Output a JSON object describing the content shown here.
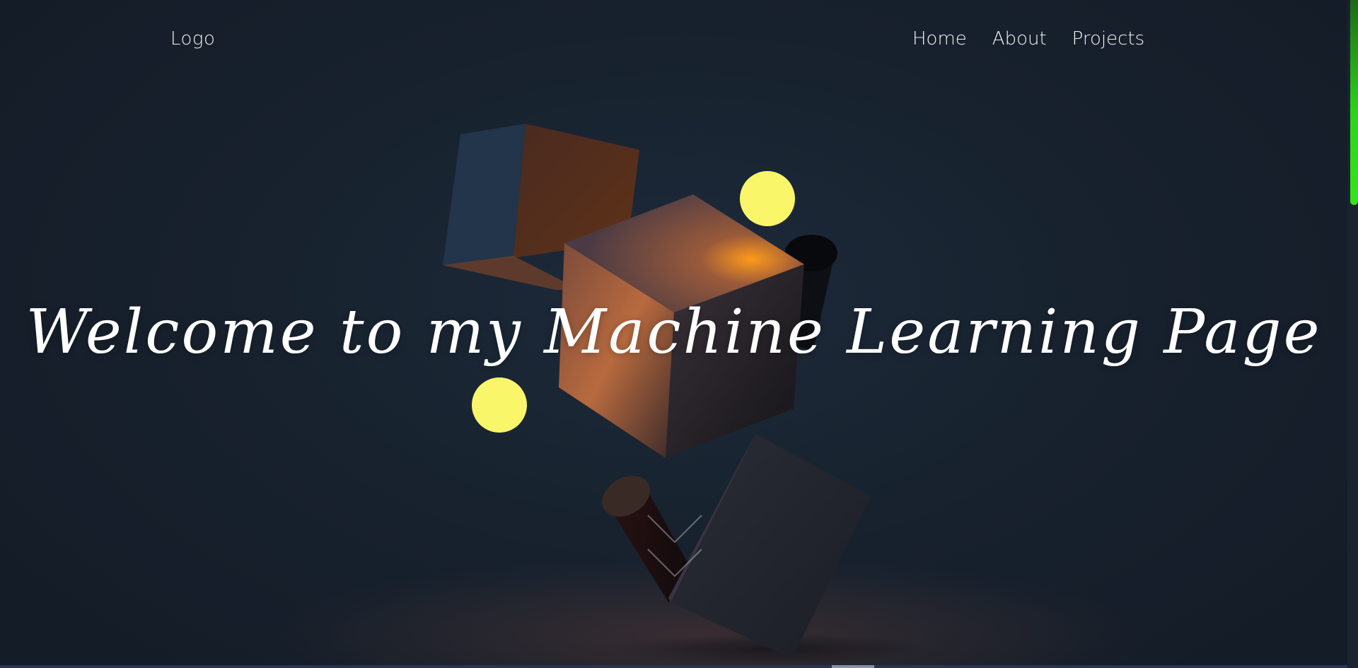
{
  "nav": {
    "logo": "Logo",
    "links": [
      "Home",
      "About",
      "Projects"
    ]
  },
  "hero": {
    "title": "Welcome to my Machine Learning Page",
    "scroll_icon": "double-chevron-down-icon"
  },
  "colors": {
    "background": "#17212d",
    "accent_sphere": "#f9f66a",
    "scroll_thumb": "#35e41d",
    "text": "#ffffff"
  }
}
